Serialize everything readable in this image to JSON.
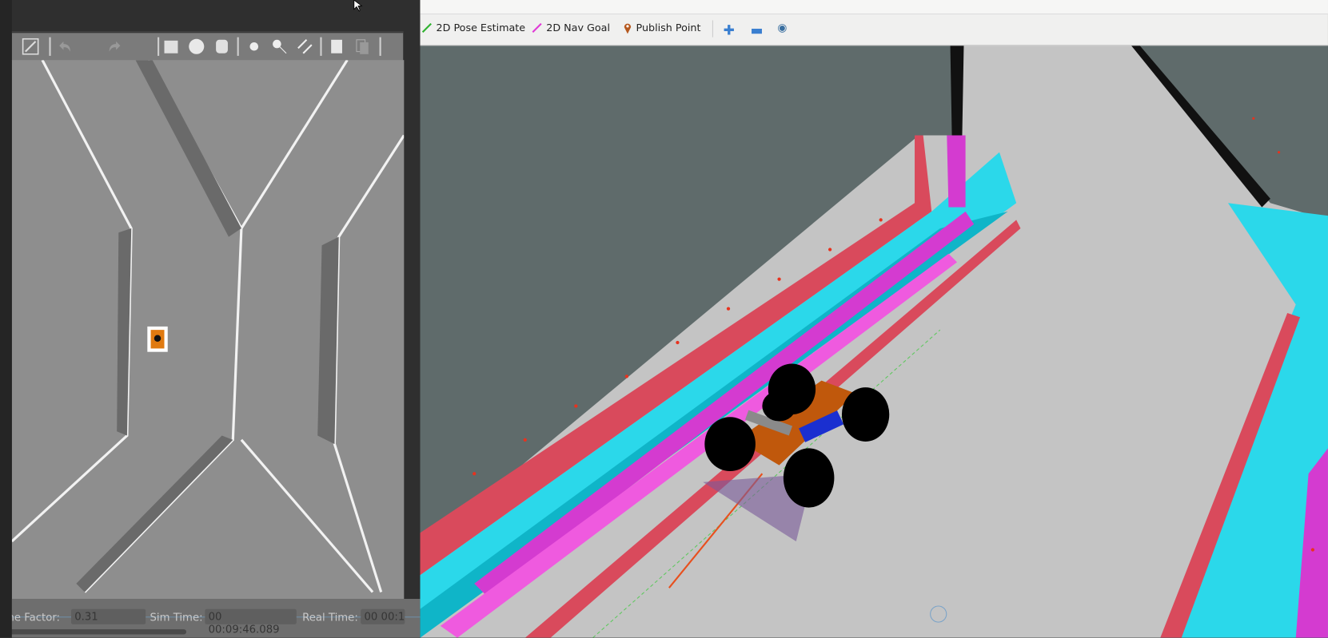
{
  "rviz": {
    "toolbar": {
      "pose_estimate": "2D Pose Estimate",
      "nav_goal": "2D Nav Goal",
      "publish_point": "Publish Point"
    }
  },
  "gazebo": {
    "status": {
      "time_factor_label": "Time Factor:",
      "time_factor_value": "0.31",
      "sim_time_label": "Sim Time:",
      "sim_time_value": "00 00:09:46.089",
      "real_time_label": "Real Time:",
      "real_time_value": "00 00:1"
    }
  },
  "colors": {
    "floor": "#c4c4c4",
    "walls": "#5f6b6b",
    "cost_cyan": "#2bd8ea",
    "cost_dark_cyan": "#0fb5c8",
    "cost_magenta": "#d43bd0",
    "cost_pink": "#ef5adf",
    "cost_red": "#d94a5c",
    "robot_base": "#c0580c"
  }
}
